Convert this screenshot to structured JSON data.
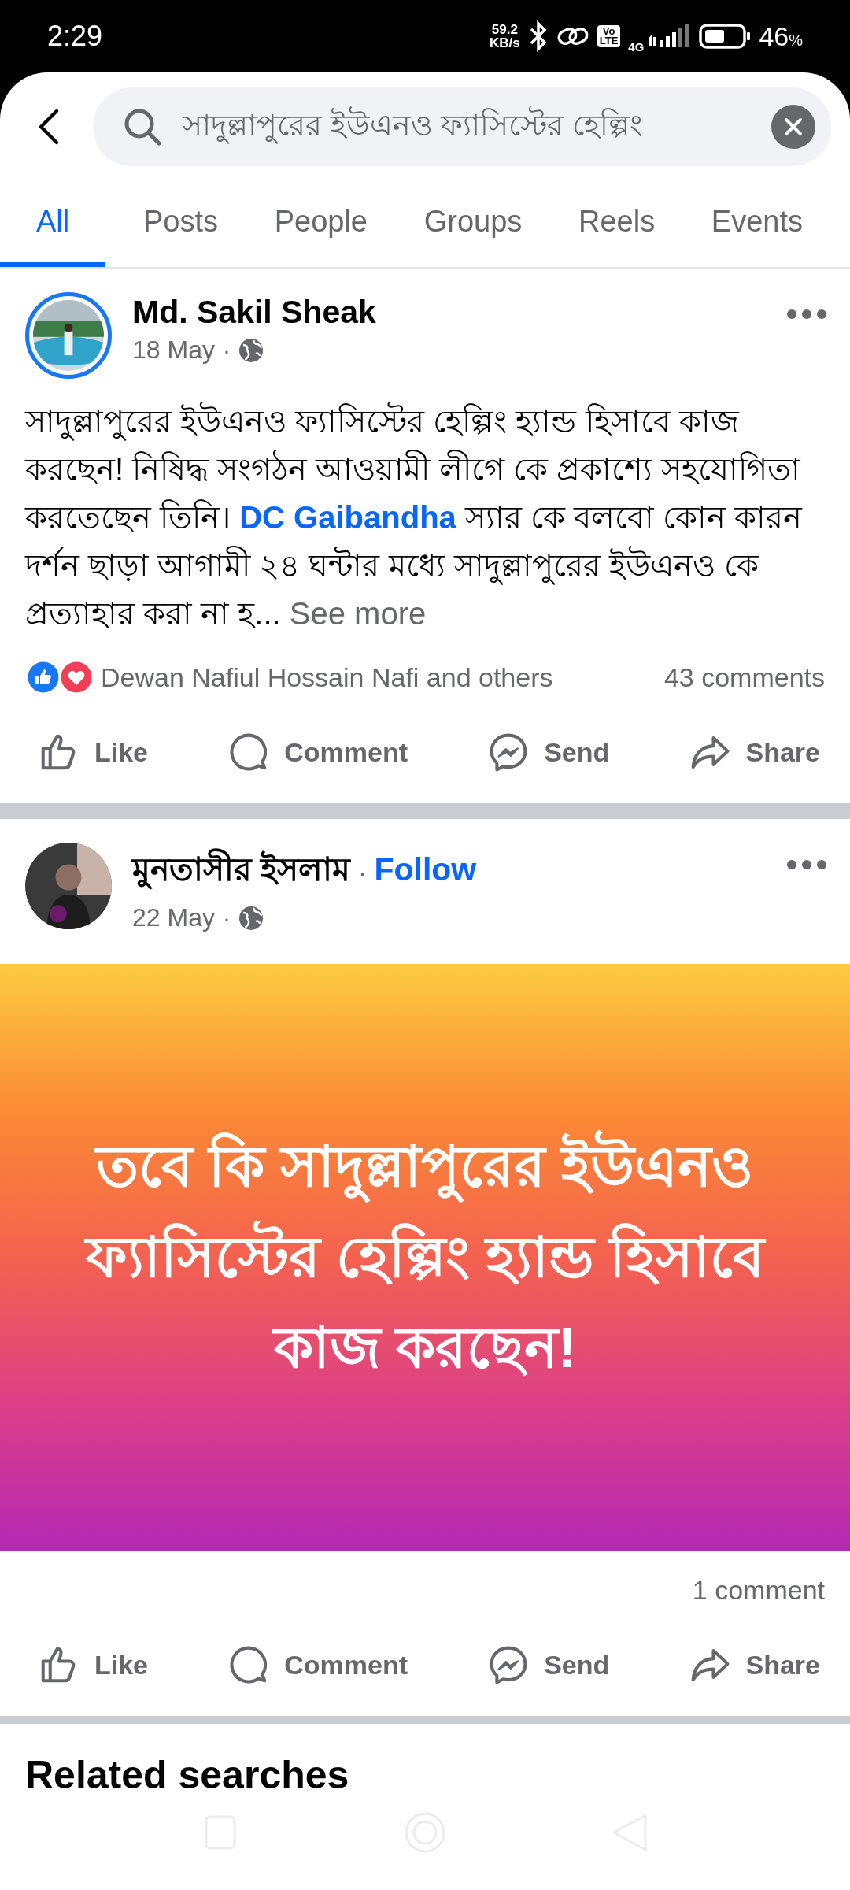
{
  "status_bar": {
    "time": "2:29",
    "net_speed": "59.2",
    "net_unit": "KB/s",
    "volte": "Vo\nLTE",
    "network": "4G",
    "battery": "46",
    "battery_unit": "%"
  },
  "search": {
    "value": "সাদুল্লাপুরের ইউএনও ফ্যাসিস্টের হেল্পিং"
  },
  "tabs": [
    {
      "label": "All",
      "selected": true
    },
    {
      "label": "Posts",
      "selected": false
    },
    {
      "label": "People",
      "selected": false
    },
    {
      "label": "Groups",
      "selected": false
    },
    {
      "label": "Reels",
      "selected": false
    },
    {
      "label": "Events",
      "selected": false
    }
  ],
  "posts": [
    {
      "author": "Md. Sakil Sheak",
      "avatar_ring": true,
      "date": "18 May",
      "date_dot": "·",
      "body": [
        {
          "kind": "text",
          "text": "সাদুল্লাপুরের ইউএনও ফ্যাসিস্টের হেল্পিং হ্যান্ড হিসাবে কাজ করছেন! নিষিদ্ধ সংগঠন আওয়ামী লীগে কে প্রকাশ্যে সহযোগিতা করতেছেন তিনি। "
        },
        {
          "kind": "link",
          "text": "DC Gaibandha"
        },
        {
          "kind": "text",
          "text": "  স্যার কে বলবো কোন কারন দর্শন ছাড়া আগামী ২৪ ঘন্টার মধ্যে সাদুল্লাপুরের ইউএনও কে প্রত্যাহার করা না হ..."
        }
      ],
      "see_more": "See more",
      "reactions": "Dewan Nafiul Hossain Nafi and others",
      "comments": "43 comments",
      "actions": [
        {
          "kind": "like",
          "label": "Like"
        },
        {
          "kind": "comment",
          "label": "Comment"
        },
        {
          "kind": "send",
          "label": "Send"
        },
        {
          "kind": "share",
          "label": "Share"
        }
      ]
    },
    {
      "author": "মুনতাসীর ইসলাম",
      "avatar_ring": false,
      "name_dot": "·",
      "follow": "Follow",
      "date": "22 May",
      "date_dot": "·",
      "background_text": "তবে কি সাদুল্লাপুরের ইউএনও  ফ্যাসিস্টের হেল্পিং হ্যান্ড হিসাবে কাজ করছেন!",
      "comments": "1 comment",
      "actions": [
        {
          "kind": "like",
          "label": "Like"
        },
        {
          "kind": "comment",
          "label": "Comment"
        },
        {
          "kind": "send",
          "label": "Send"
        },
        {
          "kind": "share",
          "label": "Share"
        }
      ]
    }
  ],
  "related_heading": "Related searches"
}
